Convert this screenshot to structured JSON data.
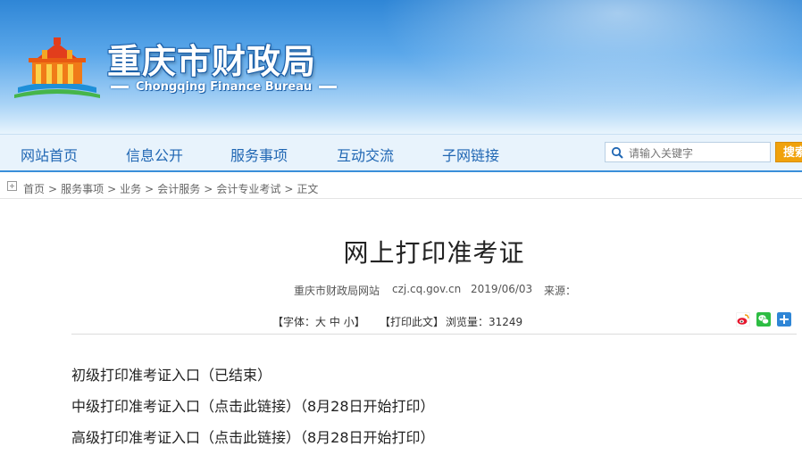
{
  "header": {
    "site_title": "重庆市财政局",
    "site_subtitle": "Chongqing Finance Bureau"
  },
  "nav": {
    "items": [
      "网站首页",
      "信息公开",
      "服务事项",
      "互动交流",
      "子网链接"
    ],
    "search_placeholder": "请输入关键字",
    "search_button": "搜索"
  },
  "breadcrumb": {
    "items": [
      "首页",
      "服务事项",
      "业务",
      "会计服务",
      "会计专业考试",
      "正文"
    ],
    "separator": ">"
  },
  "article": {
    "title": "网上打印准考证",
    "source": "重庆市财政局网站",
    "domain": "czj.cq.gov.cn",
    "date": "2019/06/03",
    "origin_label": "来源：",
    "font_label": "【字体：",
    "font_large": "大",
    "font_medium": "中",
    "font_small": "小",
    "font_close": "】",
    "print_label": "【打印此文】",
    "views_label": "浏览量：",
    "views": "31249",
    "entries": [
      "初级打印准考证入口（已结束）",
      "中级打印准考证入口（点击此链接）（8月28日开始打印）",
      "高级打印准考证入口（点击此链接）（8月28日开始打印）"
    ]
  },
  "colors": {
    "nav_text": "#1f66b3",
    "search_button": "#f0a20c",
    "header_blue": "#2f86d6"
  },
  "icons": [
    "search-icon",
    "home-icon",
    "weibo-share-icon",
    "wechat-share-icon",
    "more-share-icon"
  ]
}
